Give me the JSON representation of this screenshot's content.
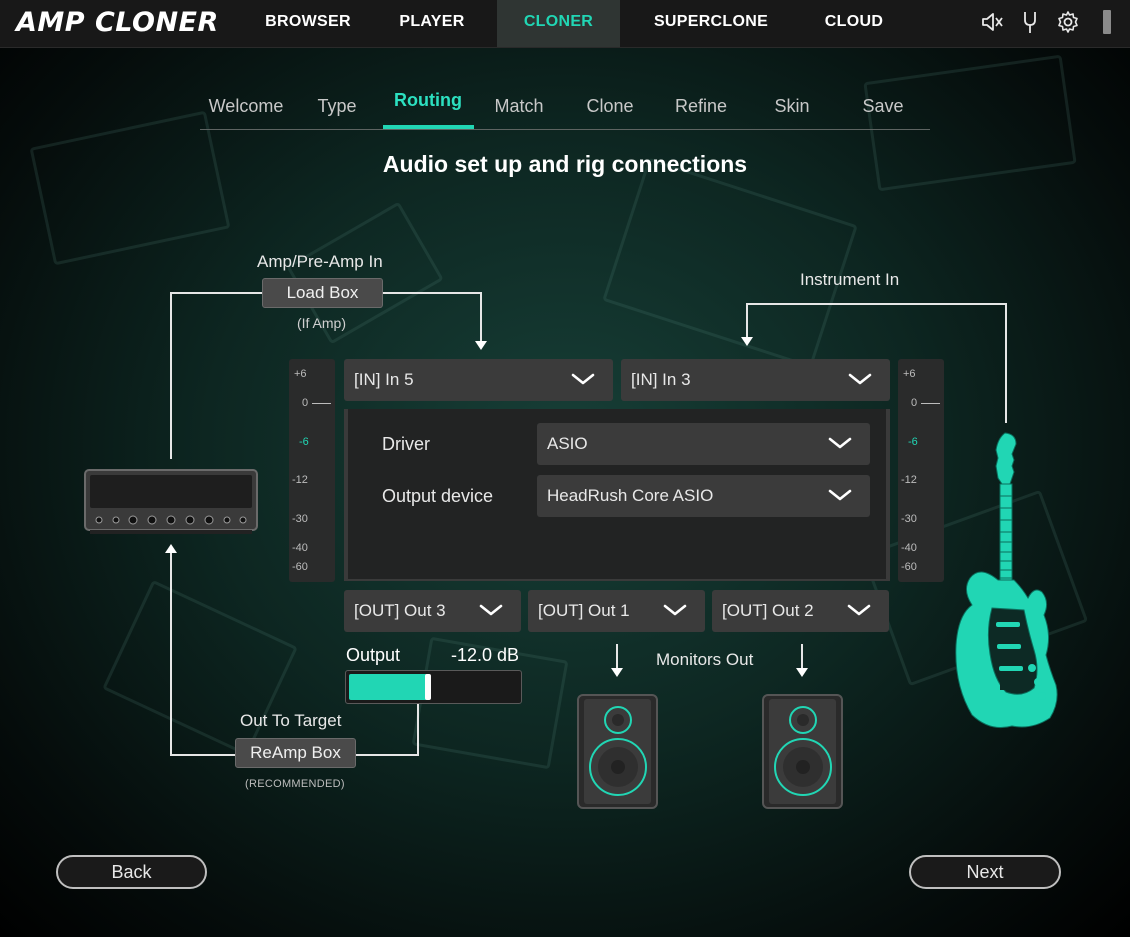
{
  "app": {
    "logo": "AMP CLONER"
  },
  "nav": {
    "items": [
      {
        "label": "BROWSER"
      },
      {
        "label": "PLAYER"
      },
      {
        "label": "CLONER"
      },
      {
        "label": "SUPERCLONE"
      },
      {
        "label": "CLOUD"
      }
    ],
    "icons": [
      "speaker-icon",
      "tuning-fork-icon",
      "gear-icon"
    ],
    "active_color": "#21d6b4"
  },
  "steps": {
    "items": [
      "Welcome",
      "Type",
      "Routing",
      "Match",
      "Clone",
      "Refine",
      "Skin",
      "Save"
    ],
    "active": "Routing"
  },
  "title": "Audio set up and rig connections",
  "left": {
    "top_label": "Amp/Pre-Amp In",
    "loadbox": "Load Box",
    "if_amp": "(If Amp)",
    "out_to_target": "Out To Target",
    "reamp": "ReAmp Box",
    "recommended": "(RECOMMENDED)"
  },
  "right": {
    "instrument_in": "Instrument In"
  },
  "inputs": {
    "in_left": "[IN] In 5",
    "in_right": "[IN] In 3"
  },
  "settings": {
    "driver_label": "Driver",
    "driver_value": "ASIO",
    "output_device_label": "Output device",
    "output_device_value": "HeadRush Core ASIO"
  },
  "outputs": {
    "out_a": "[OUT] Out 3",
    "out_b": "[OUT] Out 1",
    "out_c": "[OUT] Out 2"
  },
  "output_level": {
    "label": "Output",
    "value": "-12.0 dB",
    "fill_fraction": 0.47
  },
  "monitors": {
    "label": "Monitors Out"
  },
  "meter_ticks": [
    "+6",
    "0",
    "-6",
    "-12",
    "-30",
    "-40",
    "-60"
  ],
  "buttons": {
    "back": "Back",
    "next": "Next"
  }
}
